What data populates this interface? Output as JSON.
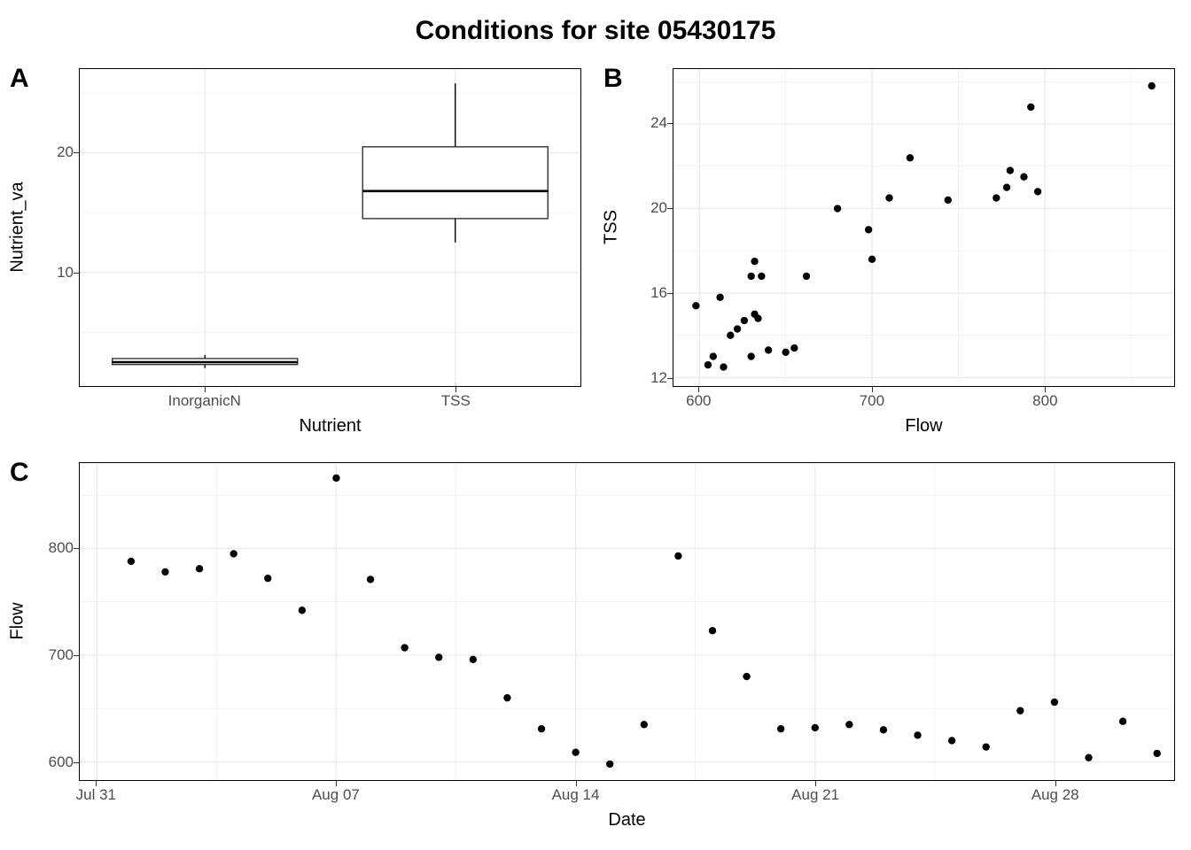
{
  "title": "Conditions for site 05430175",
  "panels": {
    "A": {
      "label": "A",
      "xlabel": "Nutrient",
      "ylabel": "Nutrient_va",
      "x_ticks": [
        "InorganicN",
        "TSS"
      ],
      "y_ticks": [
        10,
        20
      ],
      "y_range": [
        0.5,
        27
      ]
    },
    "B": {
      "label": "B",
      "xlabel": "Flow",
      "ylabel": "TSS",
      "x_ticks": [
        600,
        700,
        800
      ],
      "y_ticks": [
        12,
        16,
        20,
        24
      ],
      "x_range": [
        585,
        875
      ],
      "y_range": [
        11.6,
        26.6
      ]
    },
    "C": {
      "label": "C",
      "xlabel": "Date",
      "ylabel": "Flow",
      "x_ticks": [
        "Jul 31",
        "Aug 07",
        "Aug 14",
        "Aug 21",
        "Aug 28"
      ],
      "x_tick_days": [
        0,
        7,
        14,
        21,
        28
      ],
      "y_ticks": [
        600,
        700,
        800
      ],
      "x_range": [
        -0.5,
        31.5
      ],
      "y_range": [
        583,
        880
      ]
    }
  },
  "chart_data": [
    {
      "panel": "A",
      "type": "boxplot",
      "categories": [
        "InorganicN",
        "TSS"
      ],
      "boxes": [
        {
          "name": "InorganicN",
          "min": 2.0,
          "q1": 2.3,
          "median": 2.5,
          "q3": 2.8,
          "max": 3.1
        },
        {
          "name": "TSS",
          "min": 12.5,
          "q1": 14.5,
          "median": 16.8,
          "q3": 20.5,
          "max": 25.8
        }
      ],
      "xlabel": "Nutrient",
      "ylabel": "Nutrient_va"
    },
    {
      "panel": "B",
      "type": "scatter",
      "xlabel": "Flow",
      "ylabel": "TSS",
      "points": [
        {
          "x": 598,
          "y": 15.4
        },
        {
          "x": 605,
          "y": 12.6
        },
        {
          "x": 608,
          "y": 13.0
        },
        {
          "x": 612,
          "y": 15.8
        },
        {
          "x": 614,
          "y": 12.5
        },
        {
          "x": 618,
          "y": 14.0
        },
        {
          "x": 622,
          "y": 14.3
        },
        {
          "x": 626,
          "y": 14.7
        },
        {
          "x": 630,
          "y": 16.8
        },
        {
          "x": 630,
          "y": 13.0
        },
        {
          "x": 632,
          "y": 15.0
        },
        {
          "x": 632,
          "y": 17.5
        },
        {
          "x": 634,
          "y": 14.8
        },
        {
          "x": 636,
          "y": 16.8
        },
        {
          "x": 640,
          "y": 13.3
        },
        {
          "x": 650,
          "y": 13.2
        },
        {
          "x": 655,
          "y": 13.4
        },
        {
          "x": 662,
          "y": 16.8
        },
        {
          "x": 680,
          "y": 20.0
        },
        {
          "x": 698,
          "y": 19.0
        },
        {
          "x": 700,
          "y": 17.6
        },
        {
          "x": 710,
          "y": 20.5
        },
        {
          "x": 722,
          "y": 22.4
        },
        {
          "x": 744,
          "y": 20.4
        },
        {
          "x": 772,
          "y": 20.5
        },
        {
          "x": 778,
          "y": 21.0
        },
        {
          "x": 780,
          "y": 21.8
        },
        {
          "x": 788,
          "y": 21.5
        },
        {
          "x": 792,
          "y": 24.8
        },
        {
          "x": 796,
          "y": 20.8
        },
        {
          "x": 862,
          "y": 25.8
        }
      ]
    },
    {
      "panel": "C",
      "type": "scatter",
      "xlabel": "Date",
      "ylabel": "Flow",
      "x_description": "Days after Jul 31",
      "points": [
        {
          "x": 1,
          "y": 788
        },
        {
          "x": 2,
          "y": 778
        },
        {
          "x": 3,
          "y": 781
        },
        {
          "x": 4,
          "y": 795
        },
        {
          "x": 5,
          "y": 772
        },
        {
          "x": 6,
          "y": 742
        },
        {
          "x": 7,
          "y": 866
        },
        {
          "x": 8,
          "y": 771
        },
        {
          "x": 9,
          "y": 707
        },
        {
          "x": 10,
          "y": 698
        },
        {
          "x": 11,
          "y": 696
        },
        {
          "x": 12,
          "y": 660
        },
        {
          "x": 13,
          "y": 631
        },
        {
          "x": 14,
          "y": 609
        },
        {
          "x": 15,
          "y": 598
        },
        {
          "x": 16,
          "y": 635
        },
        {
          "x": 17,
          "y": 793
        },
        {
          "x": 18,
          "y": 723
        },
        {
          "x": 19,
          "y": 680
        },
        {
          "x": 20,
          "y": 631
        },
        {
          "x": 21,
          "y": 632
        },
        {
          "x": 22,
          "y": 635
        },
        {
          "x": 23,
          "y": 630
        },
        {
          "x": 24,
          "y": 625
        },
        {
          "x": 25,
          "y": 620
        },
        {
          "x": 26,
          "y": 614
        },
        {
          "x": 27,
          "y": 648
        },
        {
          "x": 28,
          "y": 656
        },
        {
          "x": 29,
          "y": 604
        },
        {
          "x": 30,
          "y": 638
        },
        {
          "x": 31,
          "y": 608
        }
      ]
    }
  ]
}
